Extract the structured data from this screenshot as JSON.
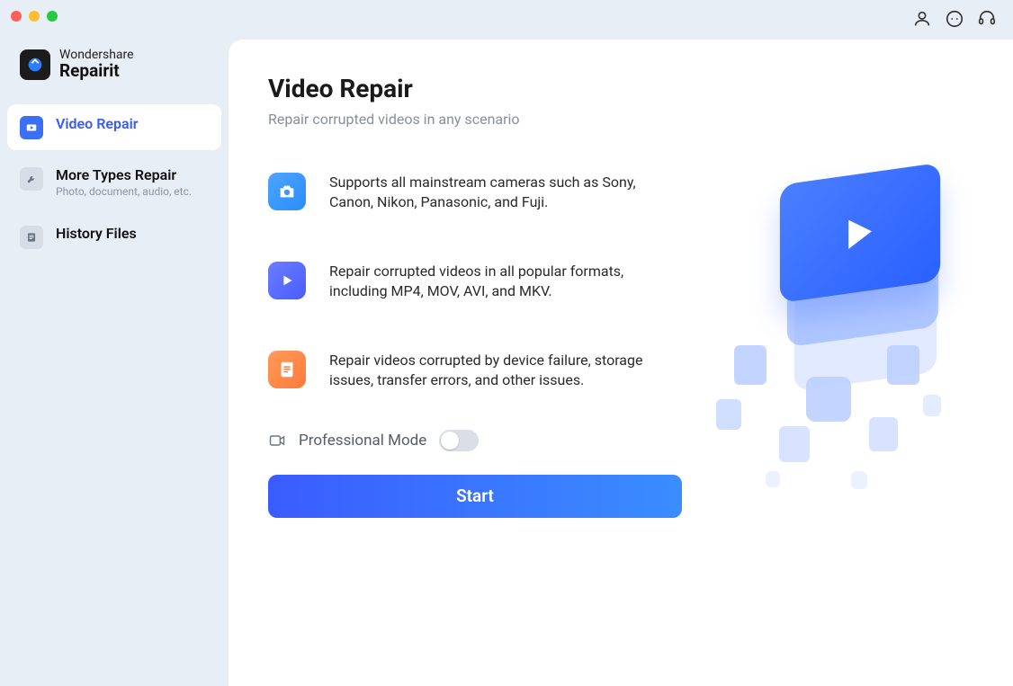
{
  "app": {
    "brand_line1": "Wondershare",
    "brand_line2": "Repairit"
  },
  "sidebar": {
    "items": [
      {
        "label": "Video Repair",
        "sub": ""
      },
      {
        "label": "More Types Repair",
        "sub": "Photo, document, audio, etc."
      },
      {
        "label": "History Files",
        "sub": ""
      }
    ]
  },
  "main": {
    "title": "Video Repair",
    "subtitle": "Repair corrupted videos in any scenario",
    "features": [
      "Supports all mainstream cameras such as Sony, Canon, Nikon, Panasonic, and Fuji.",
      "Repair corrupted videos in all popular formats, including MP4, MOV, AVI, and MKV.",
      "Repair videos corrupted by device failure, storage issues, transfer errors, and other issues."
    ],
    "pro_mode_label": "Professional Mode",
    "start_label": "Start"
  },
  "header_icons": [
    "user-icon",
    "chat-icon",
    "support-icon"
  ],
  "colors": {
    "accent": "#3a5cff"
  }
}
